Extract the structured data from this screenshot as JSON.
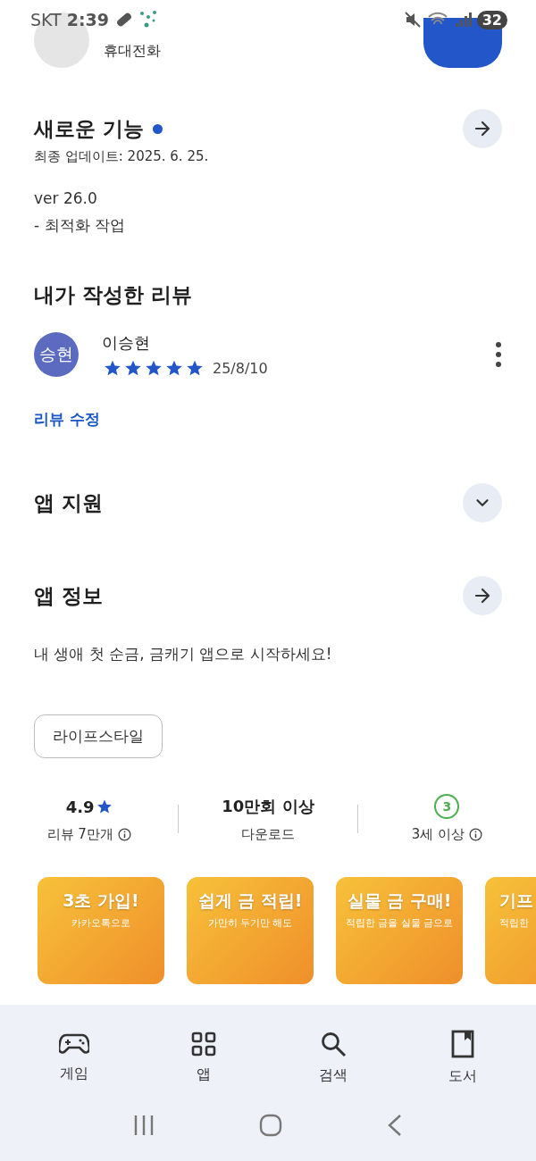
{
  "status_bar": {
    "carrier": "SKT",
    "time": "2:39",
    "battery": "32"
  },
  "app_header": {
    "category": "휴대전화"
  },
  "whats_new": {
    "title": "새로운 기능",
    "updated": "최종 업데이트: 2025. 6. 25.",
    "lines": [
      "ver 26.0",
      "- 최적화 작업"
    ]
  },
  "my_review": {
    "title": "내가 작성한 리뷰",
    "avatar": "승현",
    "name": "이승현",
    "stars": 5,
    "date": "25/8/10",
    "edit_link": "리뷰 수정"
  },
  "sections": [
    {
      "title": "앱 지원",
      "kind": "expand",
      "expanded": false
    },
    {
      "title": "앱 정보",
      "kind": "link"
    }
  ],
  "description": "내 생애 첫 순금, 금캐기 앱으로 시작하세요!",
  "tags": [
    "라이프스타일"
  ],
  "stats": [
    {
      "kind": "rating",
      "value": "4.9",
      "label": "리뷰 7만개",
      "info": true
    },
    {
      "kind": "text",
      "value": "10만회 이상",
      "label": "다운로드",
      "info": false
    },
    {
      "kind": "age",
      "value": "3",
      "label": "3세 이상",
      "info": true
    }
  ],
  "screenshots": [
    {
      "title": "3초 가입!",
      "subtitle": "카카오톡으로"
    },
    {
      "title": "쉽게 금 적립!",
      "subtitle": "가만히 두기만 해도"
    },
    {
      "title": "실물 금 구매!",
      "subtitle": "적립한 금을 실물 금으로"
    },
    {
      "title": "기프",
      "subtitle": "적립한",
      "kind": "cut"
    }
  ],
  "bottom_nav": [
    {
      "label": "게임",
      "kind": "games",
      "selected": false
    },
    {
      "label": "앱",
      "kind": "apps",
      "selected": false
    },
    {
      "label": "검색",
      "kind": "search",
      "selected": false
    },
    {
      "label": "도서",
      "kind": "books",
      "selected": false
    }
  ]
}
